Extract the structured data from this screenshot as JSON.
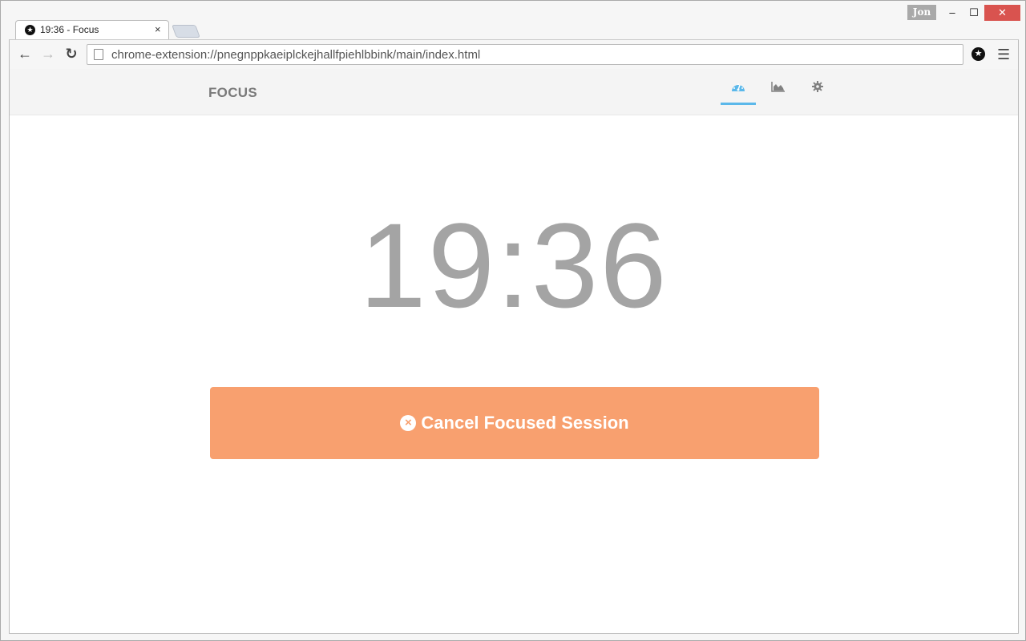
{
  "browser": {
    "tab": {
      "title": "19:36 - Focus"
    },
    "profile_name": "Jon",
    "url": "chrome-extension://pnegnppkaeiplckejhallfpiehlbbink/main/index.html",
    "window_controls": {
      "minimize": "–",
      "maximize": "☐",
      "close": "✕"
    }
  },
  "app": {
    "brand": "FOCUS",
    "nav": [
      {
        "name": "dashboard",
        "icon": "dashboard-icon",
        "active": true
      },
      {
        "name": "statistics",
        "icon": "area-chart-icon",
        "active": false
      },
      {
        "name": "settings",
        "icon": "gear-icon",
        "active": false
      }
    ],
    "timer": "19:36",
    "cancel_button": {
      "label": "Cancel Focused Session",
      "icon": "times-circle-icon"
    },
    "colors": {
      "accent": "#5bb8ea",
      "cancel": "#f8a06f",
      "timer": "#a4a4a4"
    }
  }
}
